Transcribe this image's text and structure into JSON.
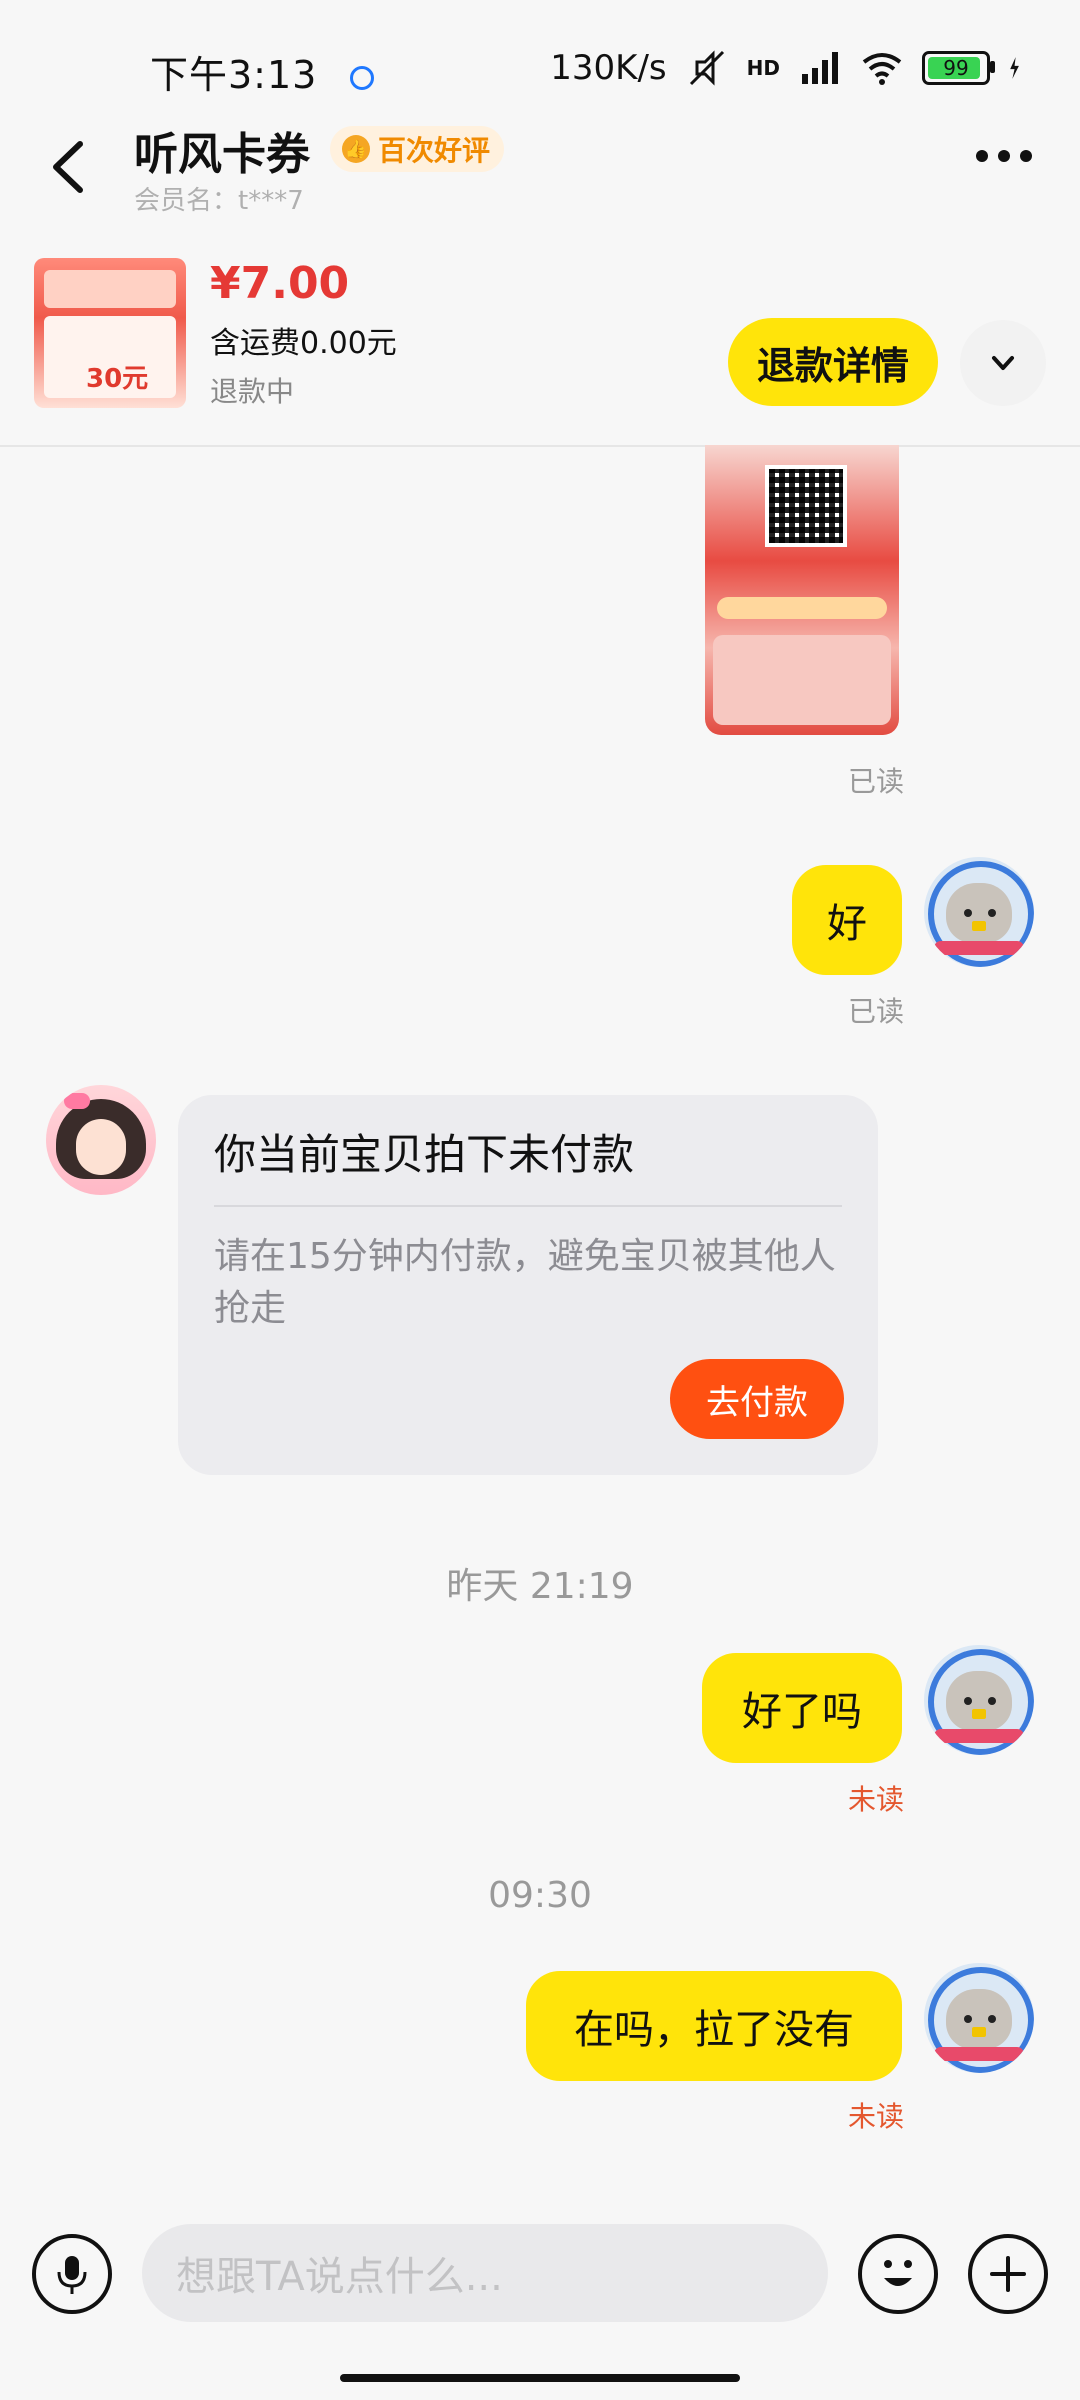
{
  "status_bar": {
    "time": "下午3:13",
    "network_speed": "130K/s",
    "network_type": "HD",
    "battery": "99",
    "icons": [
      "location-icon",
      "mute-icon",
      "signal-icon",
      "wifi-icon",
      "battery-icon",
      "charging-icon"
    ]
  },
  "header": {
    "shop_name": "听风卡券",
    "badge": "百次好评",
    "member": "会员名：t***7"
  },
  "order": {
    "price": "¥7.00",
    "shipping": "含运费0.00元",
    "status": "退款中",
    "refund_button": "退款详情",
    "thumb_text": "30元"
  },
  "messages": {
    "read_1": "已读",
    "reply_1": "好",
    "read_2": "已读",
    "card_title": "你当前宝贝拍下未付款",
    "card_desc": "请在15分钟内付款，避免宝贝被其他人抢走",
    "pay_button": "去付款",
    "time_1": "昨天 21:19",
    "reply_2": "好了吗",
    "unread_1": "未读",
    "time_2": "09:30",
    "reply_3": "在吗，拉了没有",
    "unread_2": "未读"
  },
  "input": {
    "placeholder": "想跟TA说点什么..."
  },
  "colors": {
    "accent_yellow": "#ffe40a",
    "price_red": "#e53935",
    "pay_orange": "#ff5011",
    "unread_red": "#e4572e"
  }
}
